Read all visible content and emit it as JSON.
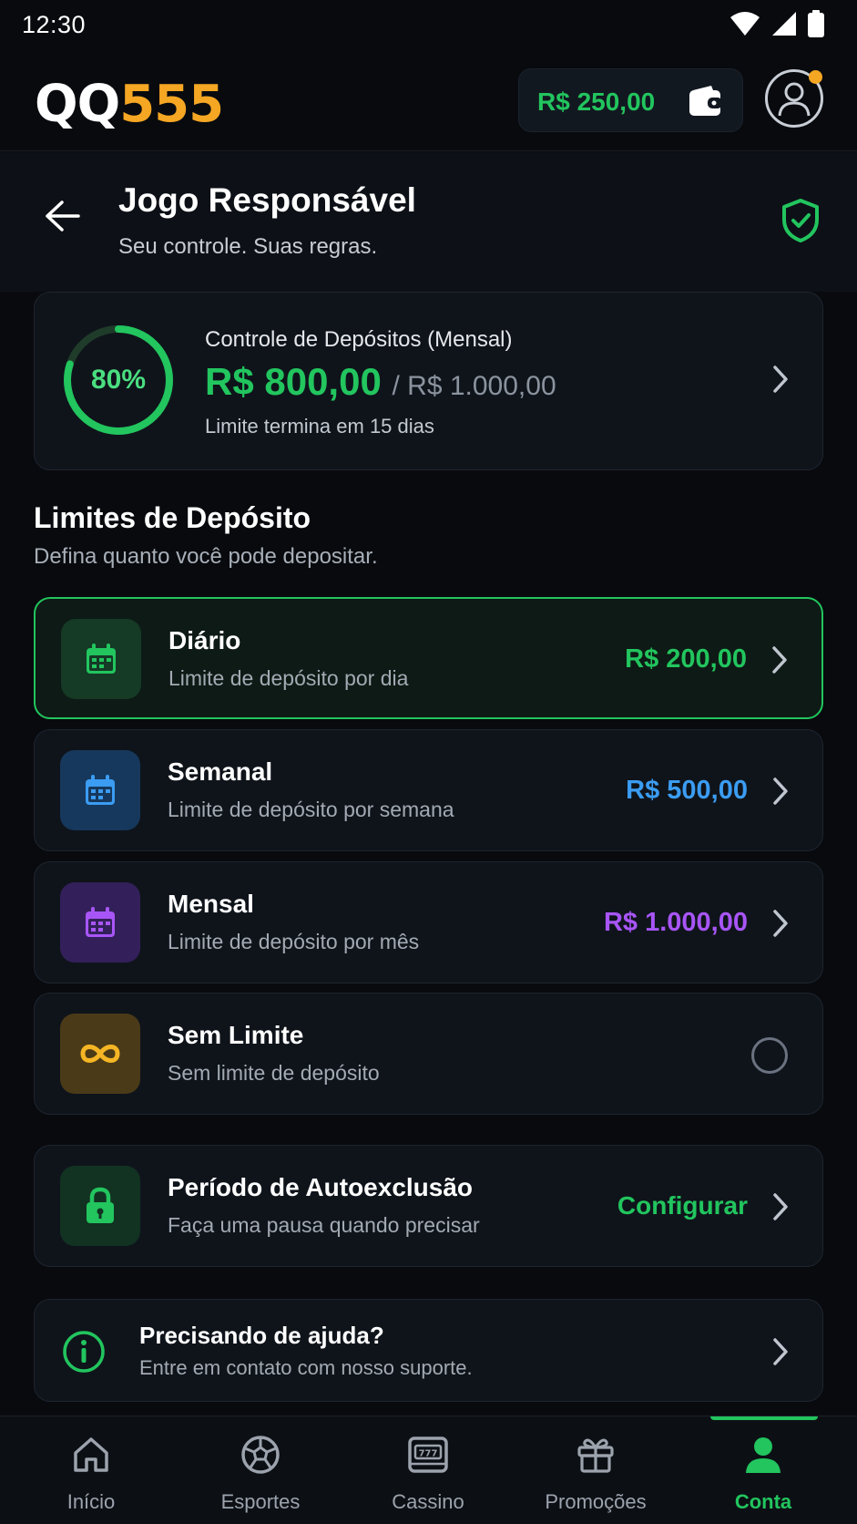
{
  "status_bar": {
    "time": "12:30"
  },
  "header": {
    "logo_primary": "QQ",
    "logo_accent": "555",
    "balance": "R$ 250,00"
  },
  "page": {
    "title": "Jogo Responsável",
    "subtitle": "Seu controle. Suas regras."
  },
  "summary": {
    "percent_label": "80%",
    "progress": 0.8,
    "label": "Controle de Depósitos (Mensal)",
    "amount": "R$ 800,00",
    "limit": "/ R$ 1.000,00",
    "note": "Limite termina em 15 dias"
  },
  "section": {
    "title": "Limites de Depósito",
    "subtitle": "Defina quanto você pode depositar."
  },
  "limits": [
    {
      "title": "Diário",
      "subtitle": "Limite de depósito por dia",
      "value": "R$ 200,00",
      "color": "#22c55e",
      "icon": "calendar-icon",
      "selected": true
    },
    {
      "title": "Semanal",
      "subtitle": "Limite de depósito por semana",
      "value": "R$ 500,00",
      "color": "#3b9cf2",
      "icon": "calendar-icon",
      "selected": false
    },
    {
      "title": "Mensal",
      "subtitle": "Limite de depósito por mês",
      "value": "R$ 1.000,00",
      "color": "#a855f7",
      "icon": "calendar-icon",
      "selected": false
    },
    {
      "title": "Sem Limite",
      "subtitle": "Sem limite de depósito",
      "value": "",
      "color": "#f5b524",
      "icon": "infinity-icon",
      "selected": false
    }
  ],
  "self_exclusion": {
    "title": "Período de Autoexclusão",
    "subtitle": "Faça uma pausa quando precisar",
    "action": "Configurar"
  },
  "help": {
    "title": "Precisando de ajuda?",
    "subtitle": "Entre em contato com nosso suporte."
  },
  "nav": [
    {
      "label": "Início",
      "icon": "home-icon"
    },
    {
      "label": "Esportes",
      "icon": "ball-icon"
    },
    {
      "label": "Cassino",
      "icon": "slot-machine-icon"
    },
    {
      "label": "Promoções",
      "icon": "gift-icon"
    },
    {
      "label": "Conta",
      "icon": "user-icon",
      "active": true
    }
  ]
}
